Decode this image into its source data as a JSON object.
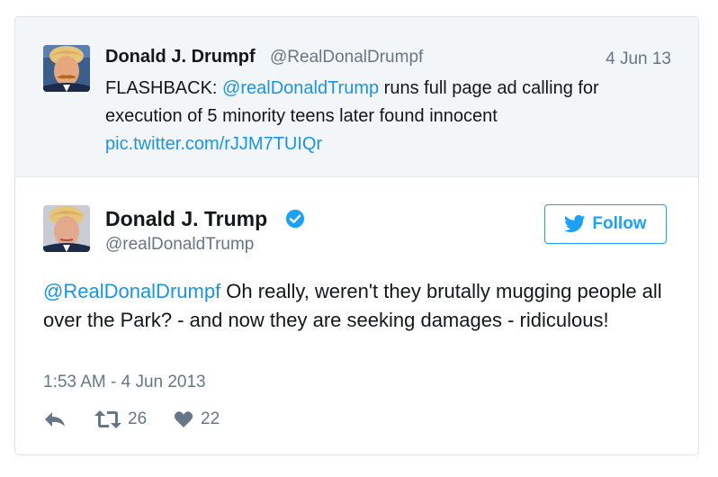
{
  "quoted_tweet": {
    "name": "Donald J. Drumpf",
    "handle": "@RealDonalDrumpf",
    "date": "4 Jun 13",
    "text_prefix": "FLASHBACK: ",
    "mention": "@realDonaldTrump",
    "text_body": " runs full page ad calling for execution of 5 minority teens later found innocent",
    "link": "pic.twitter.com/rJJM7TUIQr"
  },
  "main_tweet": {
    "name": "Donald J. Trump",
    "handle": "@realDonaldTrump",
    "follow_label": "Follow",
    "mention": "@RealDonalDrumpf",
    "text_body": " Oh really, weren't they brutally mugging people all over the Park? - and now they are seeking damages - ridiculous!",
    "timestamp": "1:53 AM - 4 Jun 2013",
    "retweet_count": "26",
    "like_count": "22"
  },
  "icons": {
    "verified": "verified-badge-icon",
    "follow": "twitter-bird-icon",
    "reply": "reply-icon",
    "retweet": "retweet-icon",
    "like": "heart-icon"
  },
  "colors": {
    "link": "#1b95e0",
    "follow": "#1da1f2",
    "secondary_text": "#657786",
    "quoted_background": "#f3f6f9"
  }
}
